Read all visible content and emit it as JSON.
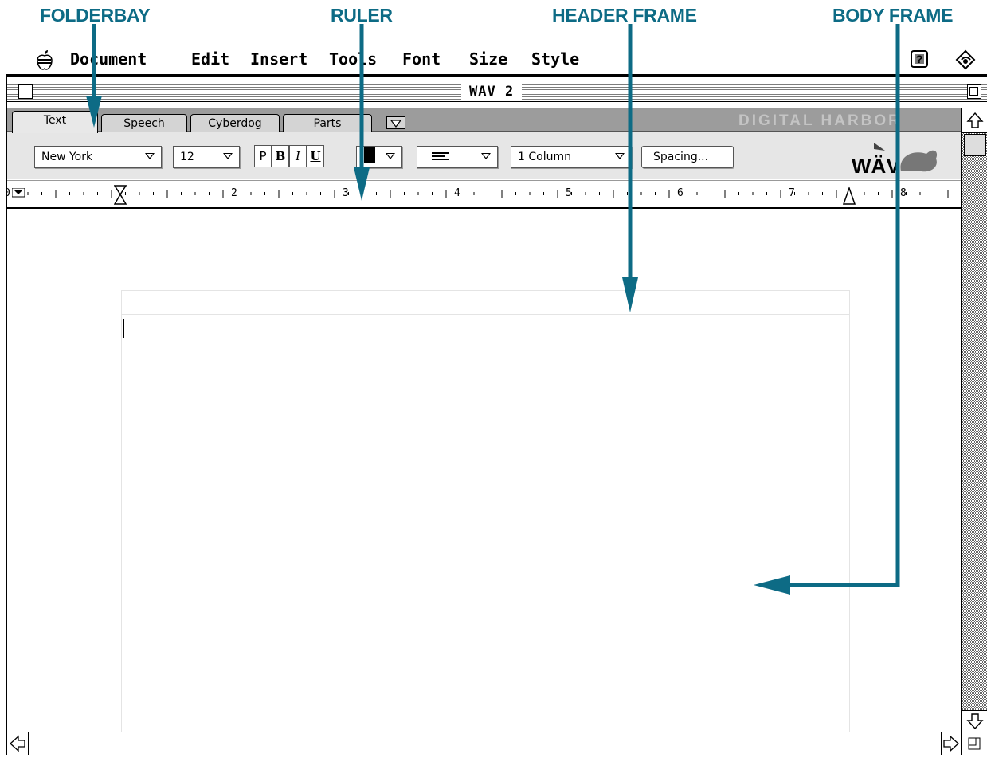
{
  "callouts": {
    "folderbay": "FOLDERBAY",
    "ruler": "RULER",
    "header_frame": "HEADER FRAME",
    "body_frame": "BODY FRAME"
  },
  "menubar": {
    "items": [
      "Document",
      "Edit",
      "Insert",
      "Tools",
      "Font",
      "Size",
      "Style"
    ]
  },
  "window": {
    "title": "WAV 2"
  },
  "folderbay": {
    "tabs": [
      "Text",
      "Speech",
      "Cyberdog",
      "Parts"
    ],
    "active_tab": "Text",
    "brand": "DIGITAL HARBOR"
  },
  "toolbar": {
    "font": "New York",
    "size": "12",
    "plain": "P",
    "bold": "B",
    "italic": "I",
    "underline": "U",
    "color": "#000000",
    "columns": "1 Column",
    "spacing": "Spacing...",
    "logo": "WÄV"
  },
  "ruler": {
    "numbers": [
      "0",
      "2",
      "3",
      "4",
      "5",
      "6",
      "7",
      "8"
    ]
  },
  "colors": {
    "accent": "#0d6b85",
    "tabbar": "#9c9c9c",
    "toolbar": "#e6e6e6"
  }
}
